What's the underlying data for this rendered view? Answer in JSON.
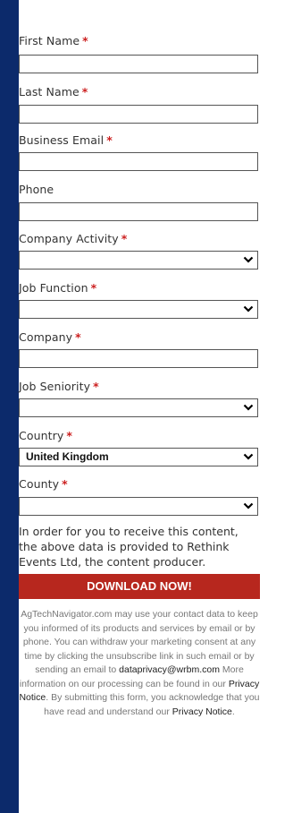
{
  "form": {
    "fields": [
      {
        "label": "First Name",
        "required": "*"
      },
      {
        "label": "Last Name",
        "required": "*"
      },
      {
        "label": "Business Email",
        "required": "*"
      },
      {
        "label": "Phone"
      },
      {
        "label": "Company Activity",
        "required": "*",
        "value": ""
      },
      {
        "label": "Job Function",
        "required": "*",
        "value": ""
      },
      {
        "label": "Company",
        "required": "*"
      },
      {
        "label": "Job Seniority",
        "required": "*",
        "value": ""
      },
      {
        "label": "Country",
        "required": "*",
        "value": "United Kingdom"
      },
      {
        "label": "County",
        "required": "*",
        "value": ""
      }
    ],
    "notice": "In order for you to receive this content, the above data is provided to Rethink Events Ltd, the content producer.",
    "button_label": "DOWNLOAD NOW!",
    "legal": {
      "part1": "AgTechNavigator.com may use your contact data to keep you informed of its products and services by email or by phone. You can withdraw your marketing consent at any time by clicking the unsubscribe link in such email or by sending an email to ",
      "email": "dataprivacy@wrbm.com",
      "part2": " More information on our processing can be found in our ",
      "privacy_link_1": "Privacy Notice",
      "part3": ". By submitting this form, you acknowledge that you have read and understand our ",
      "privacy_link_2": "Privacy Notice",
      "part4": "."
    }
  },
  "colors": {
    "background": "#0c2a6b",
    "button": "#b7271e",
    "required": "#cc1f1f"
  }
}
